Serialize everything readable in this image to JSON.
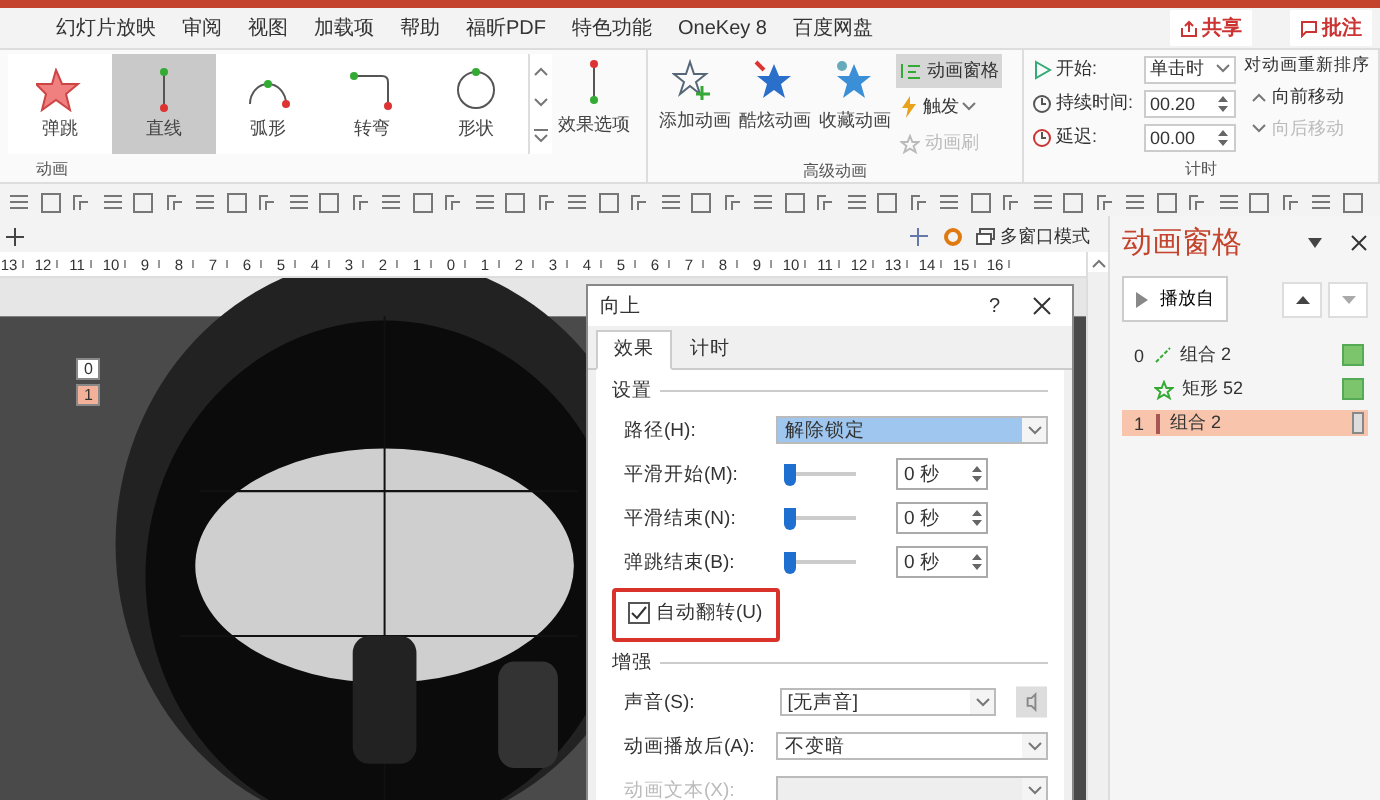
{
  "menu_tabs": [
    {
      "label": "幻灯片放映",
      "selected": false
    },
    {
      "label": "审阅",
      "selected": false
    },
    {
      "label": "视图",
      "selected": false
    },
    {
      "label": "加载项",
      "selected": false
    },
    {
      "label": "帮助",
      "selected": false
    },
    {
      "label": "福昕PDF",
      "selected": false
    },
    {
      "label": "特色功能",
      "selected": false
    },
    {
      "label": "OneKey 8",
      "selected": false
    },
    {
      "label": "百度网盘",
      "selected": false
    }
  ],
  "share_button": "共享",
  "comment_button": "批注",
  "animation_group": {
    "label": "动画",
    "effect_options": "效果选项",
    "effects": [
      {
        "label": "弹跳",
        "kind": "star",
        "selected": false
      },
      {
        "label": "直线",
        "kind": "line",
        "selected": true
      },
      {
        "label": "弧形",
        "kind": "arc",
        "selected": false
      },
      {
        "label": "转弯",
        "kind": "turn",
        "selected": false
      },
      {
        "label": "形状",
        "kind": "shape",
        "selected": false
      }
    ]
  },
  "advanced_group": {
    "label": "高级动画",
    "add_animation": "添加动画",
    "cool_animation": "酷炫动画",
    "favorite_animation": "收藏动画",
    "pane_button": {
      "label": "动画窗格",
      "selected": true
    },
    "trigger": "触发",
    "painter": {
      "label": "动画刷",
      "disabled": true
    }
  },
  "timing_group": {
    "label": "计时",
    "start_label": "开始:",
    "start_value": "单击时",
    "duration_label": "持续时间:",
    "duration_value": "00.20",
    "delay_label": "延迟:",
    "delay_value": "00.00",
    "reorder_label": "对动画重新排序",
    "move_earlier": {
      "label": "向前移动",
      "disabled": false
    },
    "move_later": {
      "label": "向后移动",
      "disabled": true
    }
  },
  "window_mode": "多窗口模式",
  "ruler": [
    "13",
    "12",
    "11",
    "10",
    "9",
    "8",
    "7",
    "6",
    "5",
    "4",
    "3",
    "2",
    "1",
    "0",
    "1",
    "2",
    "3",
    "4",
    "5",
    "6",
    "7",
    "8",
    "9",
    "10",
    "11",
    "12",
    "13",
    "14",
    "15",
    "16"
  ],
  "slide": {
    "tags": [
      {
        "label": "0",
        "selected": false
      },
      {
        "label": "1",
        "selected": true
      }
    ]
  },
  "dialog": {
    "title": "向上",
    "help": "?",
    "tabs": [
      {
        "label": "效果",
        "selected": true
      },
      {
        "label": "计时",
        "selected": false
      }
    ],
    "settings_heading": "设置",
    "path": {
      "label": "路径(H):",
      "value": "解除锁定"
    },
    "sliders": [
      {
        "label": "平滑开始(M):",
        "level": 0,
        "value": "0 秒"
      },
      {
        "label": "平滑结束(N):",
        "level": 0,
        "value": "0 秒"
      },
      {
        "label": "弹跳结束(B):",
        "level": 0,
        "value": "0 秒"
      }
    ],
    "auto_reverse": {
      "label": "自动翻转(U)",
      "checked": true,
      "highlighted": true
    },
    "enhance_heading": "增强",
    "sound": {
      "label": "声音(S):",
      "value": "[无声音]"
    },
    "after": {
      "label": "动画播放后(A):",
      "value": "不变暗"
    },
    "text_anim": {
      "label": "动画文本(X):",
      "disabled": true
    }
  },
  "pane": {
    "title": "动画窗格",
    "play_button": "播放自",
    "items": [
      {
        "index": "0",
        "label": "组合 2",
        "kind": "path",
        "selected": false
      },
      {
        "label": "矩形 52",
        "kind": "star",
        "selected": false
      },
      {
        "index": "1",
        "label": "组合 2",
        "kind": "line",
        "selected": true
      }
    ]
  }
}
